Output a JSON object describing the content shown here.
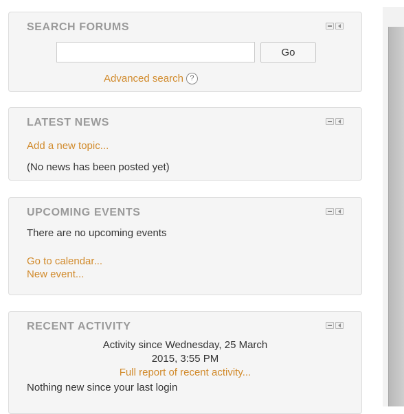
{
  "search_forums": {
    "title": "SEARCH FORUMS",
    "input_value": "",
    "go_label": "Go",
    "advanced_search": "Advanced search",
    "help_glyph": "?"
  },
  "latest_news": {
    "title": "LATEST NEWS",
    "add_topic": "Add a new topic...",
    "empty_text": "(No news has been posted yet)"
  },
  "upcoming_events": {
    "title": "UPCOMING EVENTS",
    "empty_text": "There are no upcoming events",
    "go_to_calendar": "Go to calendar...",
    "new_event": "New event..."
  },
  "recent_activity": {
    "title": "RECENT ACTIVITY",
    "since_line1": "Activity since Wednesday, 25 March",
    "since_line2": "2015, 3:55 PM",
    "full_report": "Full report of recent activity...",
    "nothing_new": "Nothing new since your last login"
  },
  "colors": {
    "link": "#d18a2b",
    "title": "#9a9a9a",
    "text": "#333333",
    "block_bg": "#f5f5f5"
  },
  "icons": {
    "block_hide": "minus-box-icon",
    "block_dock": "dock-arrow-icon",
    "help": "help-circle-icon"
  }
}
